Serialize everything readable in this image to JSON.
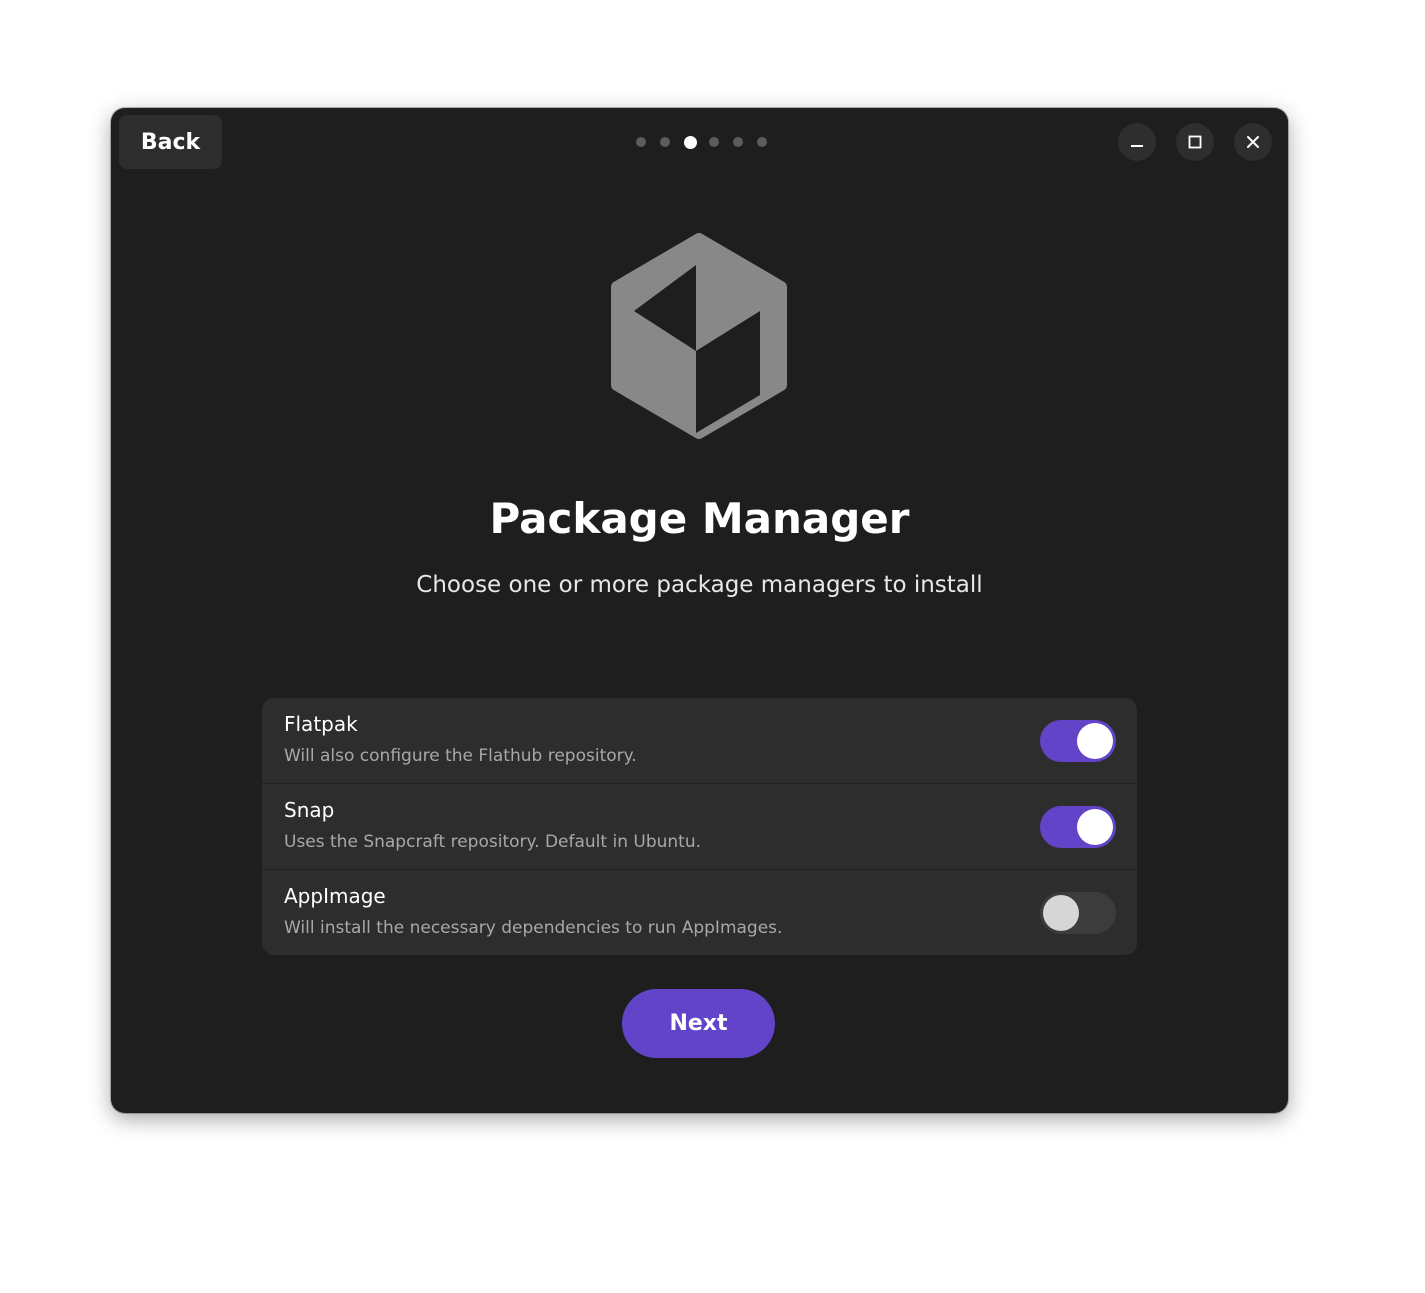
{
  "header": {
    "back_label": "Back",
    "carousel": {
      "total_pages": 6,
      "current_page": 3
    },
    "window_controls": {
      "minimize_icon": "minimize-icon",
      "maximize_icon": "maximize-icon",
      "close_icon": "close-icon"
    }
  },
  "hero": {
    "icon": "package-cube-icon",
    "title": "Package Manager",
    "subtitle": "Choose one or more package managers to install"
  },
  "options": [
    {
      "title": "Flatpak",
      "subtitle": "Will also configure the Flathub repository.",
      "enabled": true
    },
    {
      "title": "Snap",
      "subtitle": "Uses the Snapcraft repository. Default in Ubuntu.",
      "enabled": true
    },
    {
      "title": "AppImage",
      "subtitle": "Will install the necessary dependencies to run AppImages.",
      "enabled": false
    }
  ],
  "footer": {
    "next_label": "Next"
  },
  "colors": {
    "accent": "#6244c9",
    "window_background": "#1e1e1e",
    "card_background": "#2d2d2d",
    "icon_gray": "#888888"
  }
}
